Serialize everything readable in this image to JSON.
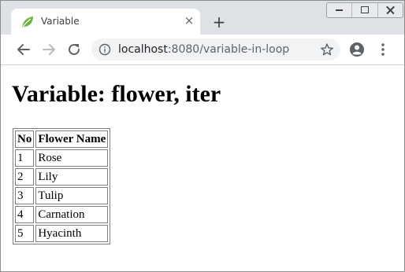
{
  "browser": {
    "tab_title": "Variable",
    "tab_close": "×",
    "new_tab": "+",
    "url_host": "localhost",
    "url_rest": ":8080/variable-in-loop",
    "colors": {
      "favicon": "#6db33f",
      "titlebar": "#dee1e6",
      "omnibox": "#f1f3f4"
    }
  },
  "page": {
    "title": "Variable: flower, iter",
    "table": {
      "headers": [
        "No",
        "Flower Name"
      ],
      "rows": [
        [
          "1",
          "Rose"
        ],
        [
          "2",
          "Lily"
        ],
        [
          "3",
          "Tulip"
        ],
        [
          "4",
          "Carnation"
        ],
        [
          "5",
          "Hyacinth"
        ]
      ]
    }
  }
}
